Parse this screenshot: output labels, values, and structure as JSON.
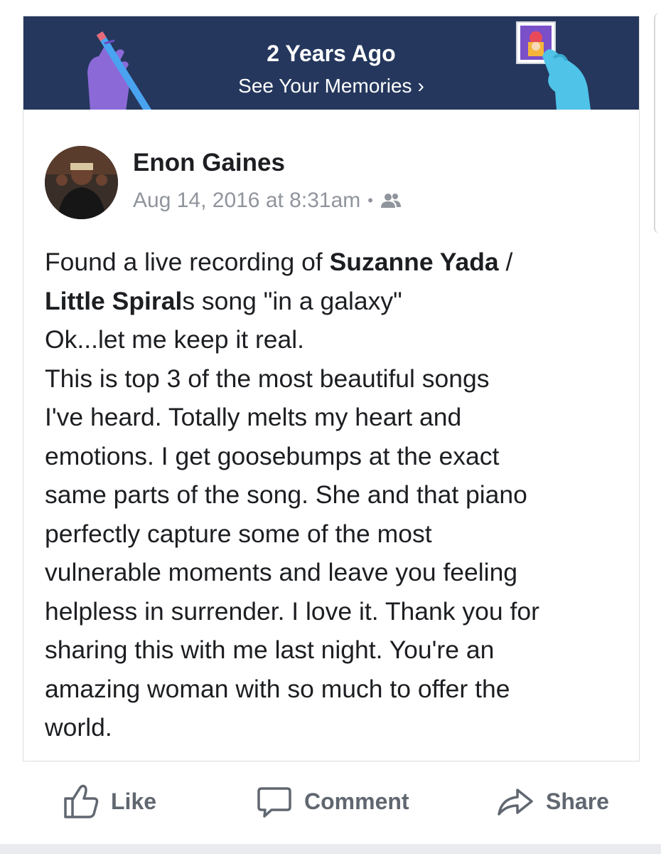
{
  "memories": {
    "title": "2 Years Ago",
    "link_label": "See Your Memories",
    "chevron": "›"
  },
  "post": {
    "author": "Enon Gaines",
    "timestamp": "Aug 14, 2016 at 8:31am",
    "meta_separator": "•",
    "privacy_icon": "friends-icon",
    "text": {
      "l1_a": "Found a live recording of ",
      "l1_b": "Suzanne Yada",
      "l1_c": " /",
      "l2_a": "Little Spiral",
      "l2_b": "s song \"in a galaxy\"",
      "l3": "Ok...let me keep it real.",
      "l4": "This is top 3 of the most beautiful songs",
      "l5": "I've heard. Totally melts my heart and",
      "l6": "emotions. I get goosebumps at the exact",
      "l7": "same parts of the song. She and that piano",
      "l8": "perfectly capture some of the most",
      "l9": "vulnerable moments and leave you feeling",
      "l10": "helpless in surrender. I love it. Thank you for",
      "l11": "sharing this with me last night. You're an",
      "l12": "amazing woman with so much to offer the",
      "l13": "world."
    }
  },
  "actions": {
    "like": "Like",
    "comment": "Comment",
    "share": "Share"
  },
  "colors": {
    "banner_bg": "#25375d",
    "meta_gray": "#90949c",
    "action_gray": "#606770"
  }
}
